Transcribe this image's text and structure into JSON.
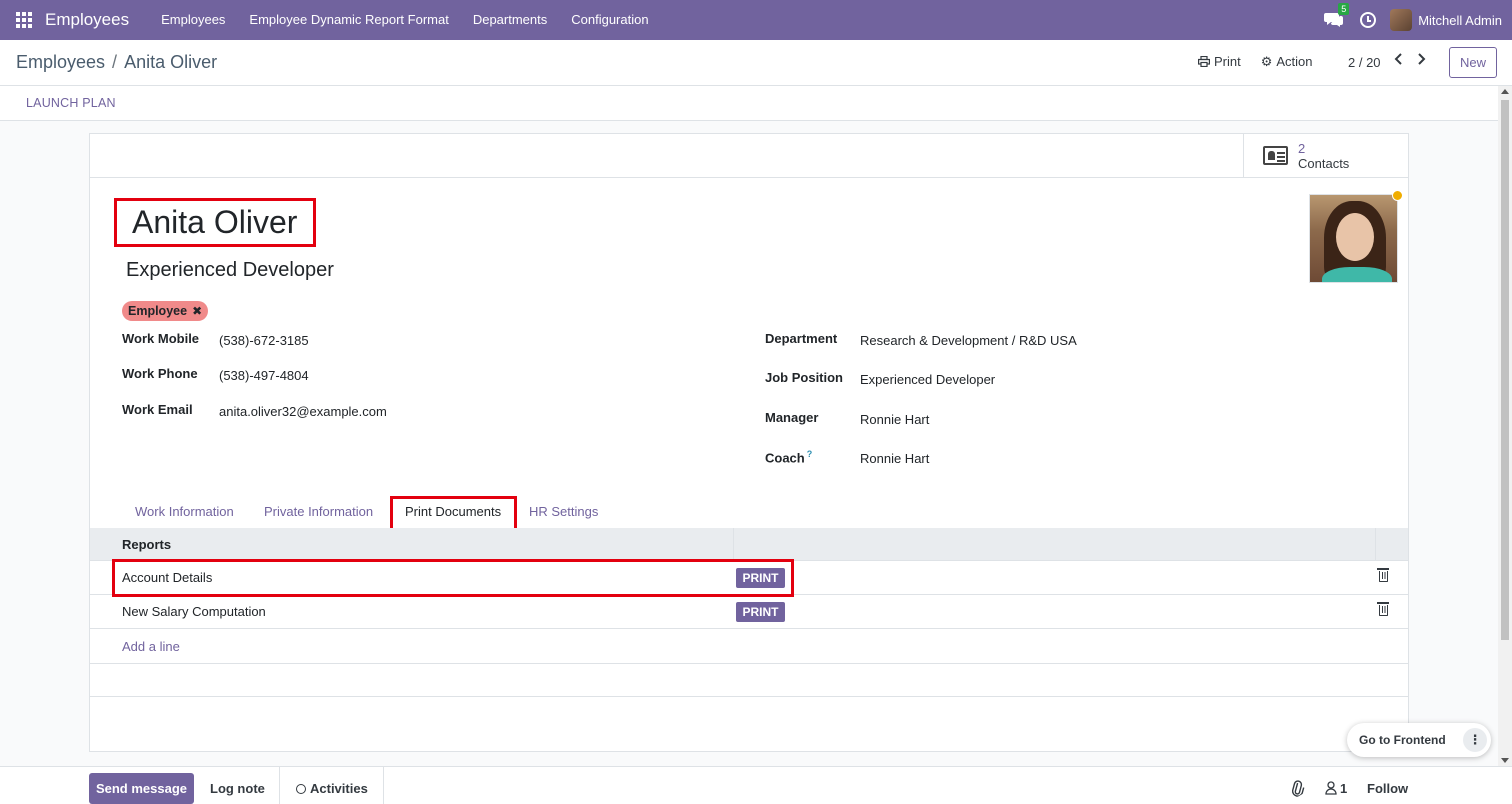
{
  "navbar": {
    "app_name": "Employees",
    "menu": [
      "Employees",
      "Employee Dynamic Report Format",
      "Departments",
      "Configuration"
    ],
    "chat_badge": "5",
    "user_name": "Mitchell Admin",
    "color": "#71639e"
  },
  "control_panel": {
    "breadcrumb_parent": "Employees",
    "breadcrumb_sep": "/",
    "breadcrumb_current": "Anita Oliver",
    "print_label": "Print",
    "action_label": "Action",
    "pager": "2 / 20",
    "new_label": "New"
  },
  "statusbar": {
    "launch_plan": "LAUNCH PLAN"
  },
  "smart_buttons": {
    "contacts_count": "2",
    "contacts_label": "Contacts"
  },
  "employee": {
    "name": "Anita Oliver",
    "job_title": "Experienced Developer",
    "tag": "Employee",
    "status_color": "#f0ad00"
  },
  "fields_left": [
    {
      "label": "Work Mobile",
      "value": "(538)-672-3185"
    },
    {
      "label": "Work Phone",
      "value": "(538)-497-4804"
    },
    {
      "label": "Work Email",
      "value": "anita.oliver32@example.com"
    }
  ],
  "fields_right": [
    {
      "label": "Department",
      "value": "Research & Development / R&D USA"
    },
    {
      "label": "Job Position",
      "value": "Experienced Developer"
    },
    {
      "label": "Manager",
      "value": "Ronnie Hart"
    },
    {
      "label": "Coach",
      "value": "Ronnie Hart",
      "help": "?"
    }
  ],
  "tabs": [
    {
      "label": "Work Information"
    },
    {
      "label": "Private Information"
    },
    {
      "label": "Print Documents",
      "active": true
    },
    {
      "label": "HR Settings"
    }
  ],
  "reports_table": {
    "header": "Reports",
    "rows": [
      {
        "name": "Account Details",
        "button": "PRINT"
      },
      {
        "name": "New Salary Computation",
        "button": "PRINT"
      }
    ],
    "add_line": "Add a line"
  },
  "chatter": {
    "send_message": "Send message",
    "log_note": "Log note",
    "activities": "Activities",
    "followers_count": "1",
    "follow": "Follow"
  },
  "frontend": {
    "label": "Go to Frontend",
    "more": "⋮"
  },
  "annotation_color": "#e3000f"
}
